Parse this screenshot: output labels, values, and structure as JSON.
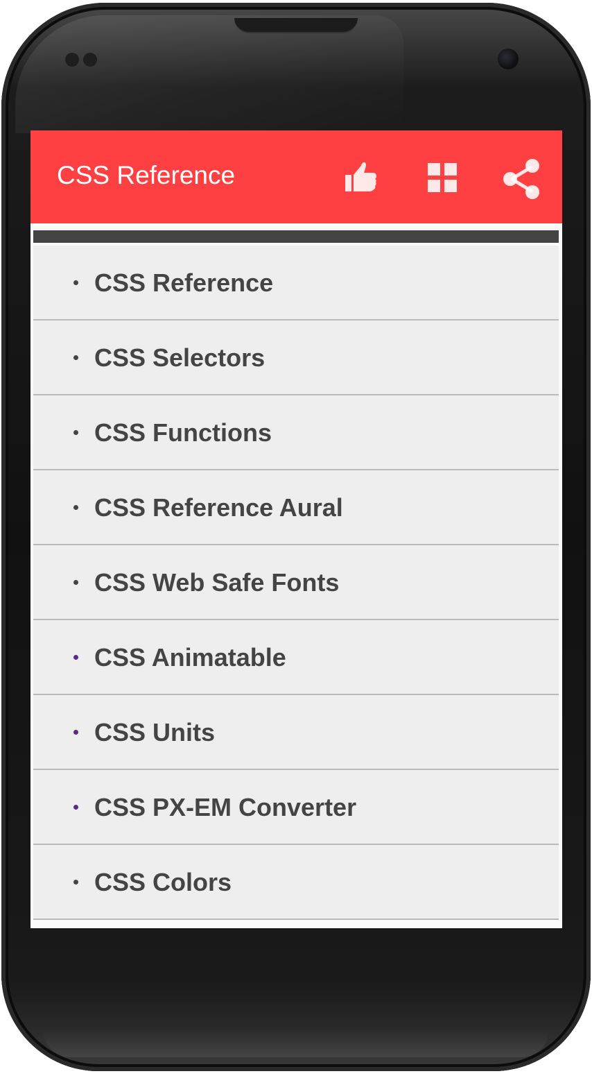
{
  "app_bar": {
    "title": "CSS Reference",
    "background_color": "#ff4043",
    "actions": [
      {
        "icon": "thumbs-up-icon"
      },
      {
        "icon": "grid-icon"
      },
      {
        "icon": "share-icon"
      }
    ]
  },
  "menu": {
    "items": [
      {
        "label": "CSS Reference",
        "bullet_color": "#444444"
      },
      {
        "label": "CSS Selectors",
        "bullet_color": "#444444"
      },
      {
        "label": "CSS Functions",
        "bullet_color": "#444444"
      },
      {
        "label": "CSS Reference Aural",
        "bullet_color": "#444444"
      },
      {
        "label": "CSS Web Safe Fonts",
        "bullet_color": "#444444"
      },
      {
        "label": "CSS Animatable",
        "bullet_color": "#5b2a86"
      },
      {
        "label": "CSS Units",
        "bullet_color": "#5b2a86"
      },
      {
        "label": "CSS PX-EM Converter",
        "bullet_color": "#5b2a86"
      },
      {
        "label": "CSS Colors",
        "bullet_color": "#444444"
      }
    ]
  }
}
